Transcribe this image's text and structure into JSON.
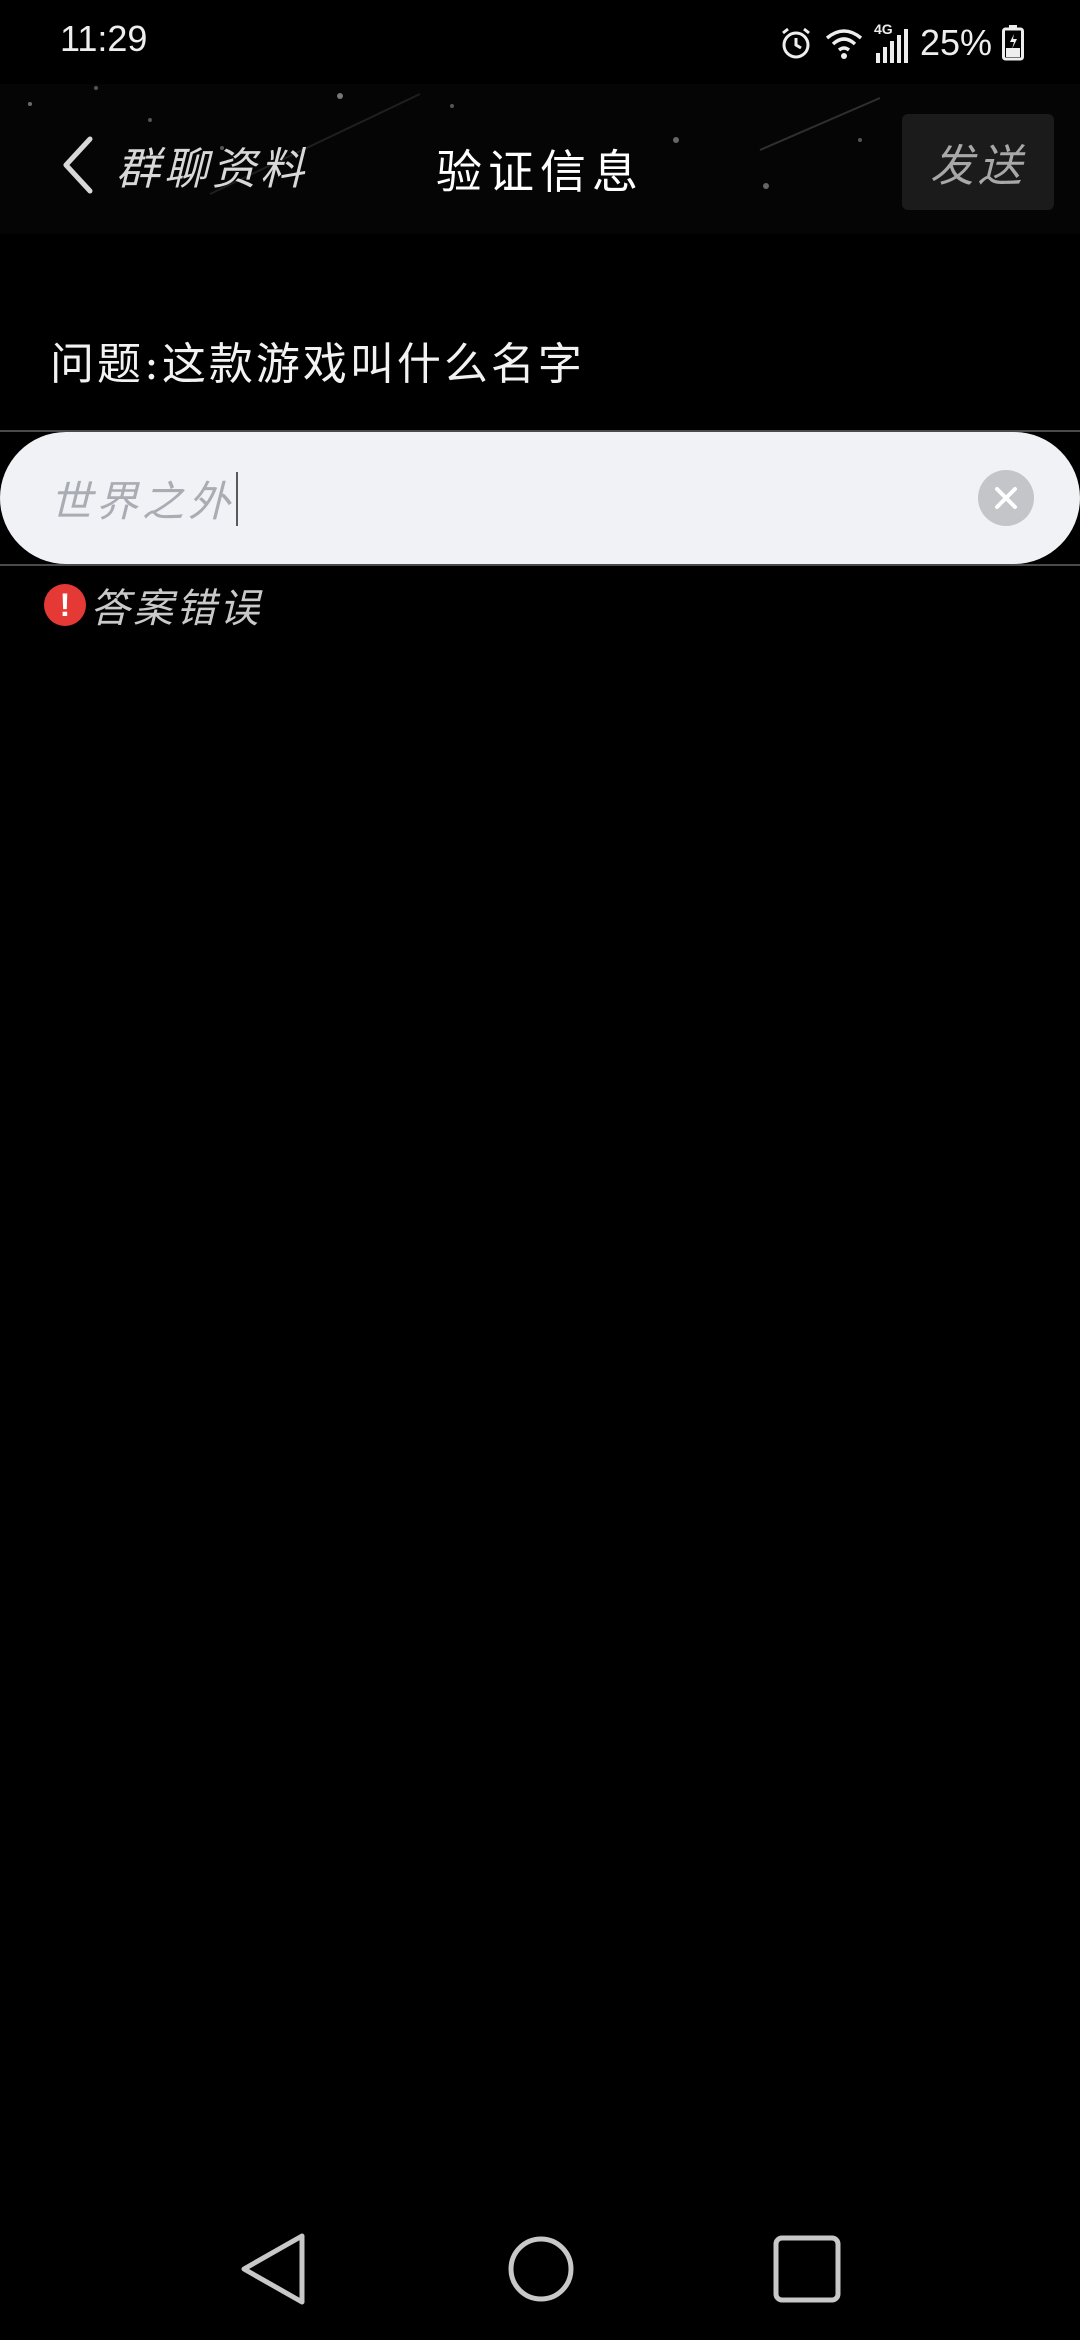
{
  "status_bar": {
    "time": "11:29",
    "network": "4G",
    "battery": "25%",
    "icons": [
      "alarm-icon",
      "wifi-icon",
      "signal-icon",
      "battery-icon"
    ]
  },
  "header": {
    "back_label": "群聊资料",
    "title": "验证信息",
    "send_label": "发送"
  },
  "question": "问题:这款游戏叫什么名字",
  "answer": {
    "value": "世界之外"
  },
  "error": {
    "icon": "!",
    "text": "答案错误"
  },
  "colors": {
    "background": "#000000",
    "input_background": "#f0f2f6",
    "error": "#e53935"
  }
}
